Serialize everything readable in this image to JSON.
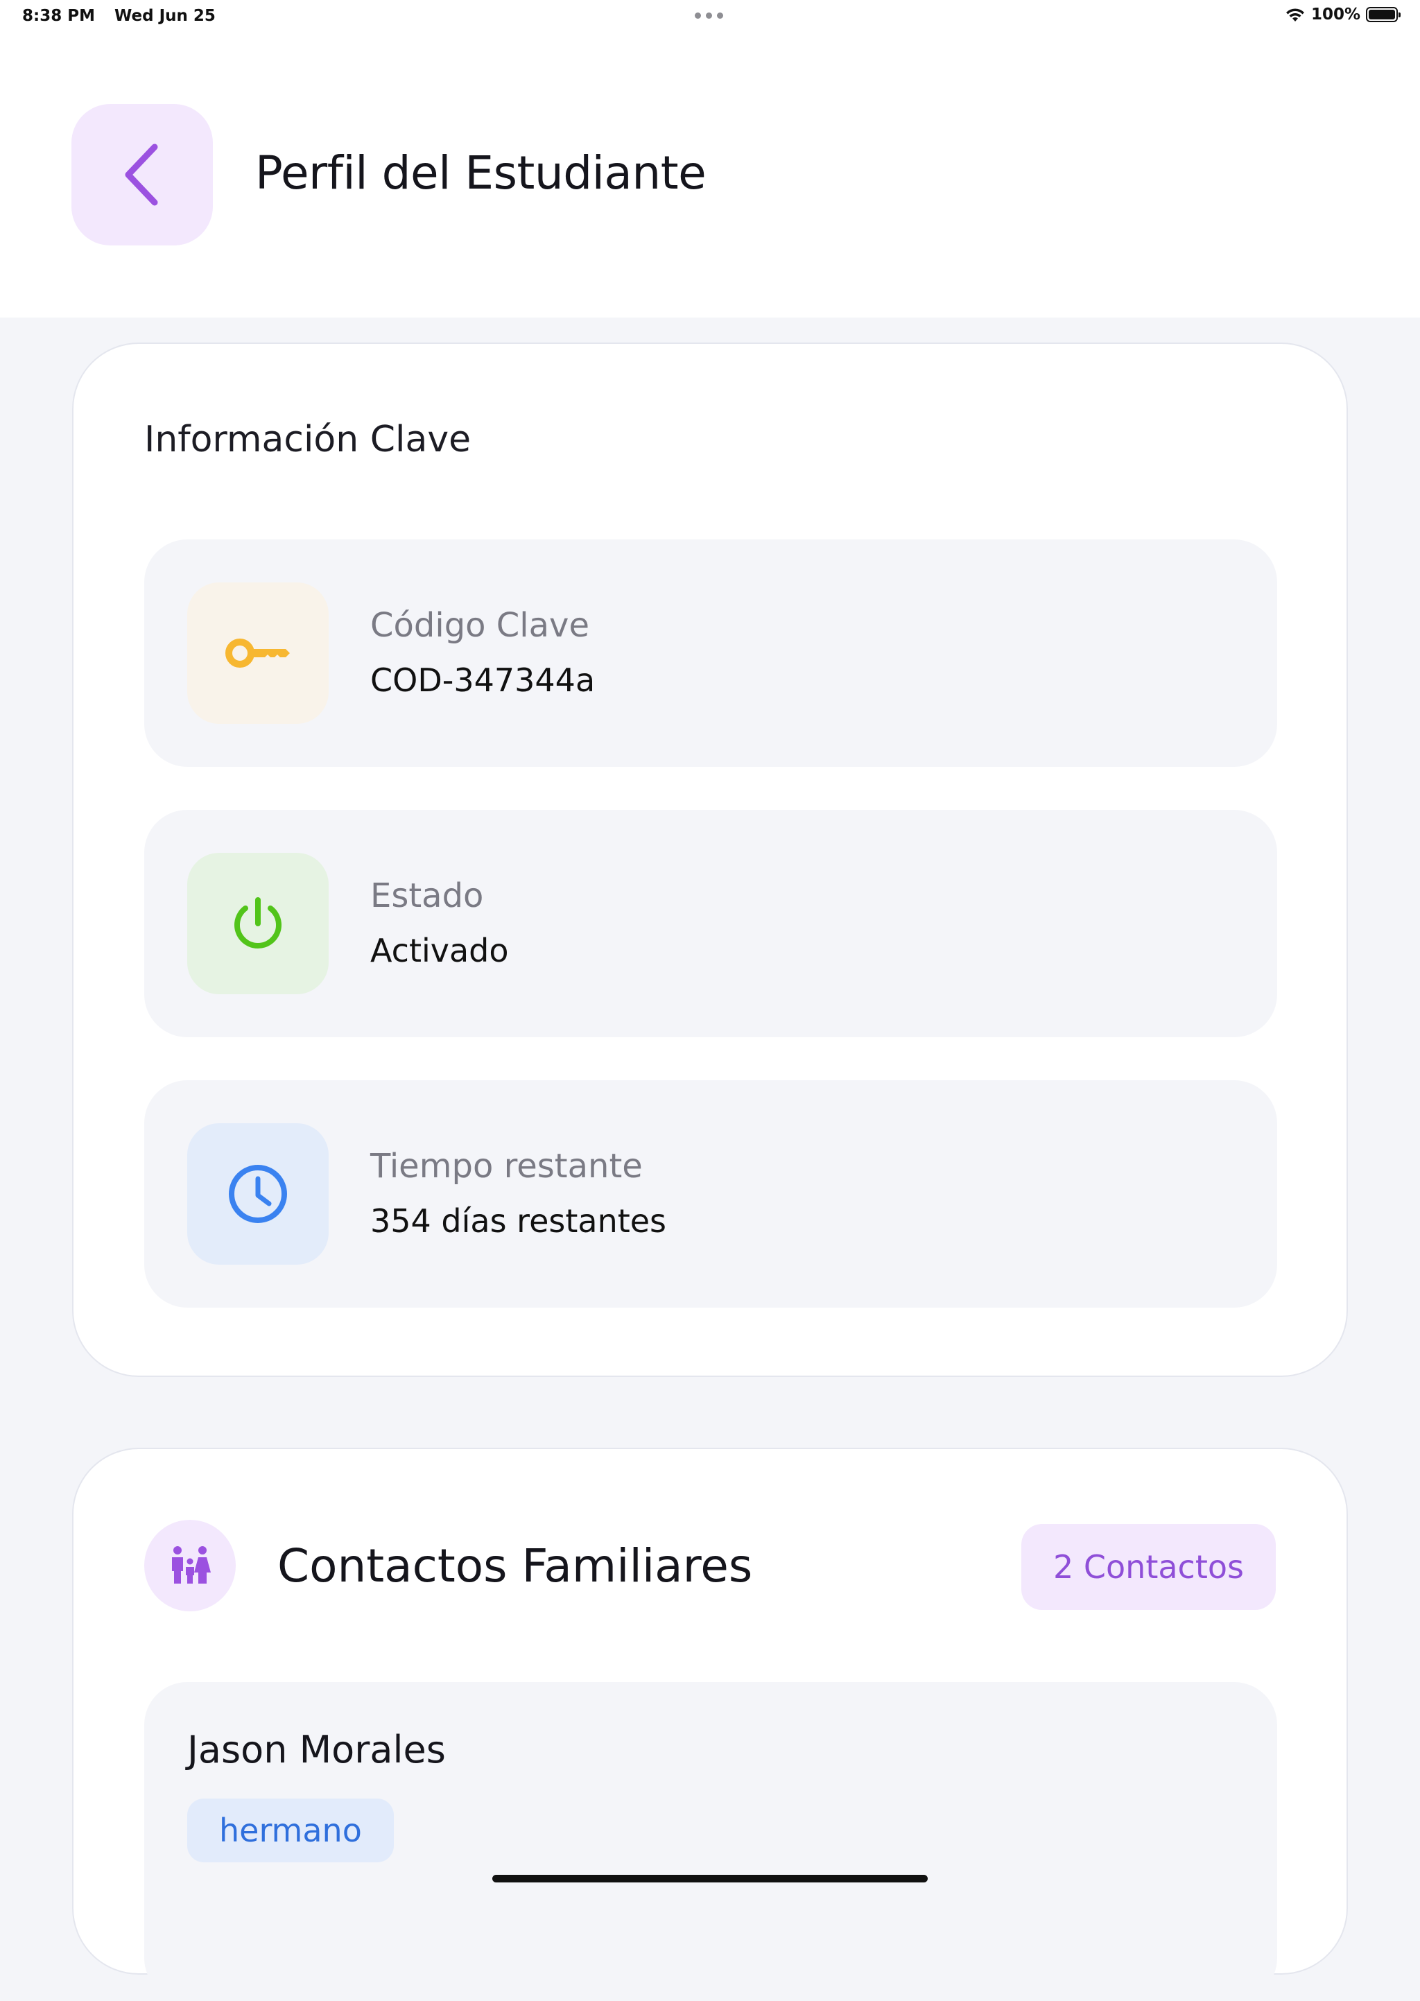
{
  "status_bar": {
    "time": "8:38 PM",
    "date": "Wed Jun 25",
    "battery": "100%",
    "battery_level": 1.0,
    "icons": [
      "wifi-icon",
      "battery-icon"
    ]
  },
  "header": {
    "back_icon": "chevron-left-icon",
    "title": "Perfil del Estudiante"
  },
  "key_info": {
    "title": "Información Clave",
    "rows": [
      {
        "label": "Código Clave",
        "value": "COD-347344a",
        "icon": "key-icon",
        "icon_color": "#f7b731",
        "icon_bg": "#f9f3ea"
      },
      {
        "label": "Estado",
        "value": "Activado",
        "icon": "power-icon",
        "icon_color": "#52c41a",
        "icon_bg": "#e6f3e3"
      },
      {
        "label": "Tiempo restante",
        "value": "354 días restantes",
        "icon": "clock-icon",
        "icon_color": "#3a82f0",
        "icon_bg": "#e3ecfa"
      }
    ]
  },
  "contacts": {
    "icon": "family-icon",
    "title": "Contactos Familiares",
    "count_badge": "2 Contactos",
    "items": [
      {
        "name": "Jason Morales",
        "relation": "hermano"
      }
    ]
  },
  "colors": {
    "accent": "#9b51e0",
    "page_bg": "#f4f5f9",
    "card_bg": "#ffffff"
  }
}
